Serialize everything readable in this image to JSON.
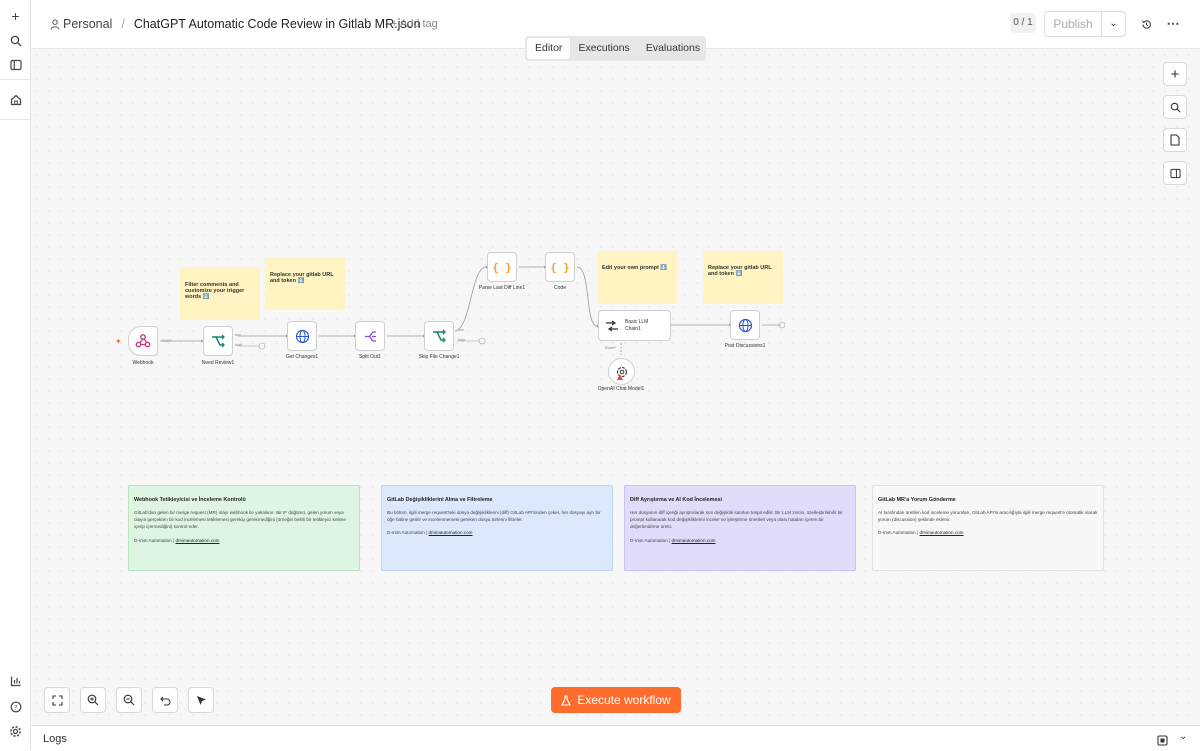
{
  "header": {
    "project": "Personal",
    "separator": "/",
    "workflow_name": "ChatGPT Automatic Code Review in Gitlab MR.json",
    "add_tag": "+ Add tag",
    "counter": "0 / 1",
    "publish_label": "Publish"
  },
  "tabs": [
    {
      "label": "Editor",
      "active": true
    },
    {
      "label": "Executions",
      "active": false
    },
    {
      "label": "Evaluations",
      "active": false
    }
  ],
  "nodes": {
    "webhook": "Webhook",
    "need_review": "Need Review1",
    "get_changes": "Get Changes1",
    "split_out": "Split Out1",
    "skip_file_change": "Skip File Change1",
    "parse_last_diff": "Parse Last Diff Line1",
    "code": "Code",
    "llm_chain": "Basic LLM Chain1",
    "llm_chain_line1": "Basic LLM",
    "llm_chain_line2": "Chain1",
    "post_discussions": "Post Discussions1",
    "openai_model": "OpenAI Chat Model1"
  },
  "port_labels": {
    "post": "POST",
    "true": "true",
    "false": "false",
    "model": "Model*"
  },
  "stickies": {
    "filter": "Filter comments and customize your trigger words ⬇️",
    "gitlab_url_1": "Replace your gitlab URL and token ⬇️",
    "prompt": "Edit your own prompt ⬇️",
    "gitlab_url_2": "Replace your gitlab URL and token ⬇️"
  },
  "notes": [
    {
      "title": "Webhook Tetikleyicisi ve İnceleme Kontrolü",
      "body": "GitLab'dan gelen bir merge request (MR) olayı webhook ile yakalanır. Bir IF düğümü, gelen yorum veya olayın gerçekten bir kod incelemesi tetiklemesi gerekip gerekmediğini (örneğin belirli bir tetikleyici kelime içerip içermediğini) kontrol eder.",
      "footer_left": "D-mim Automation",
      "footer_link": "dmimautomation.com",
      "color": "#dff5e3",
      "border": "#b9e4c2"
    },
    {
      "title": "GitLab Değişikliklerini Alma ve Filtreleme",
      "body": "Bu bölüm, ilgili merge request'teki dosya değişikliklerini (diff) GitLab API'sinden çeker, her dosyayı ayrı bir öğe haline getirir ve incelenmemesi gereken dosya türlerini filtreler.",
      "footer_left": "D-mim Automation",
      "footer_link": "dmimautomation.com",
      "color": "#dce8fb",
      "border": "#c3d6f2"
    },
    {
      "title": "Diff Ayrıştırma ve AI Kod İncelemesi",
      "body": "Her dosyanın diff içeriği ayrıştırılarak son değişiklik satırları tespit edilir. Bir LLM zinciri, özelleştirilebilir bir prompt kullanarak kod değişikliklerini inceler ve iyileştirme önerileri veya olası hataları içeren bir değerlendirme üretir.",
      "footer_left": "D-mim Automation",
      "footer_link": "dmimautomation.com",
      "color": "#e2dcfb",
      "border": "#cbc1f2"
    },
    {
      "title": "GitLab MR'a Yorum Gönderme",
      "body": "AI tarafından üretilen kod inceleme yorumları, GitLab API'si aracılığıyla ilgili merge request'e otomatik olarak yorum (discussion) şeklinde eklenir.",
      "footer_left": "D-mim Automation",
      "footer_link": "dmimautomation.com",
      "color": "#f7f7f7",
      "border": "#e2e2e2"
    }
  ],
  "execute_label": "Execute workflow",
  "logs_label": "Logs",
  "icons": {
    "sidebar": [
      "plus-icon",
      "search-icon",
      "panel-icon",
      "home-icon",
      "chart-icon",
      "help-icon",
      "settings-icon"
    ],
    "colors": {
      "accent": "#ff6d2e",
      "http": "#2b59c3",
      "if": "#14866d",
      "split": "#8a49d6",
      "code": "#f79a2b"
    }
  }
}
